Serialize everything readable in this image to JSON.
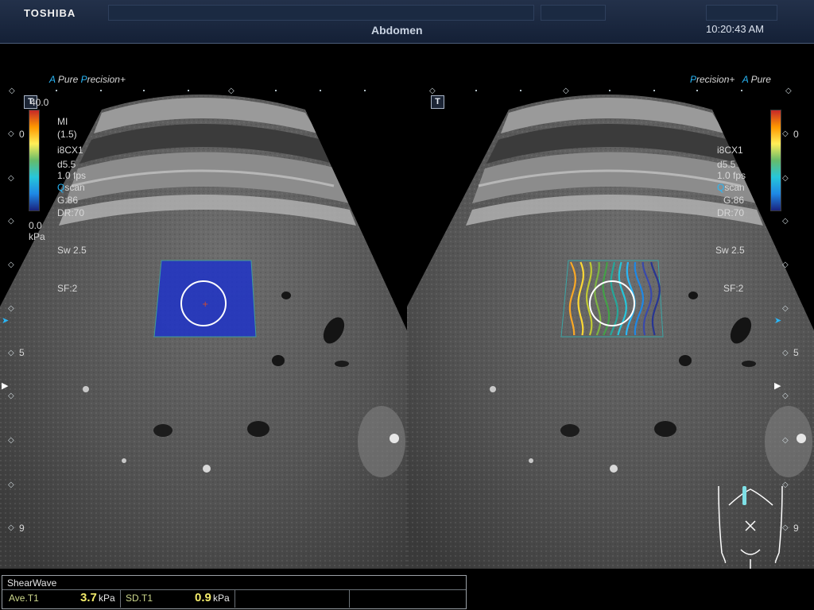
{
  "header": {
    "brand": "TOSHIBA",
    "preset": "Abdomen",
    "time": "10:20:43 AM"
  },
  "left_panel": {
    "tag_a": "A",
    "tag_pure": "Pure",
    "tag_p": "P",
    "tag_precision": "recision",
    "scale_max": "40.0",
    "scale_min": "0.0",
    "scale_unit": "kPa",
    "params": [
      "MI",
      "(1.5)",
      "i8CX1",
      "d5.5",
      "1.0 fps"
    ],
    "qscan_q": "Q",
    "qscan_rest": "scan",
    "gain": "G:86",
    "dr": "DR:70",
    "sw": "Sw 2.5",
    "sf": "SF:2"
  },
  "right_panel": {
    "tag_p": "P",
    "tag_precision": "recision",
    "tag_a": "A",
    "tag_pure": "Pure",
    "params": [
      "i8CX1",
      "d5.5",
      "1.0 fps"
    ],
    "qscan_q": "Q",
    "qscan_rest": "scan",
    "gain": "G:86",
    "dr": "DR:70",
    "sw": "Sw 2.5",
    "sf": "SF:2"
  },
  "depth_labels": {
    "top": "0",
    "mid": "5",
    "bottom": "9"
  },
  "buttons": {
    "t_label": "T"
  },
  "measurement": {
    "title": "ShearWave",
    "ave_label": "Ave.T1",
    "ave_value": "3.7",
    "ave_unit": "kPa",
    "sd_label": "SD.T1",
    "sd_value": "0.9",
    "sd_unit": "kPa"
  },
  "colors": {
    "elastogram_fill": "#1f33c8",
    "roi_circle": "#ffffff",
    "accent_cyan": "#29b6f6"
  },
  "icons": [
    "plus-icon",
    "roi-circle-icon",
    "focus-marker-icon",
    "body-mark-icon"
  ]
}
